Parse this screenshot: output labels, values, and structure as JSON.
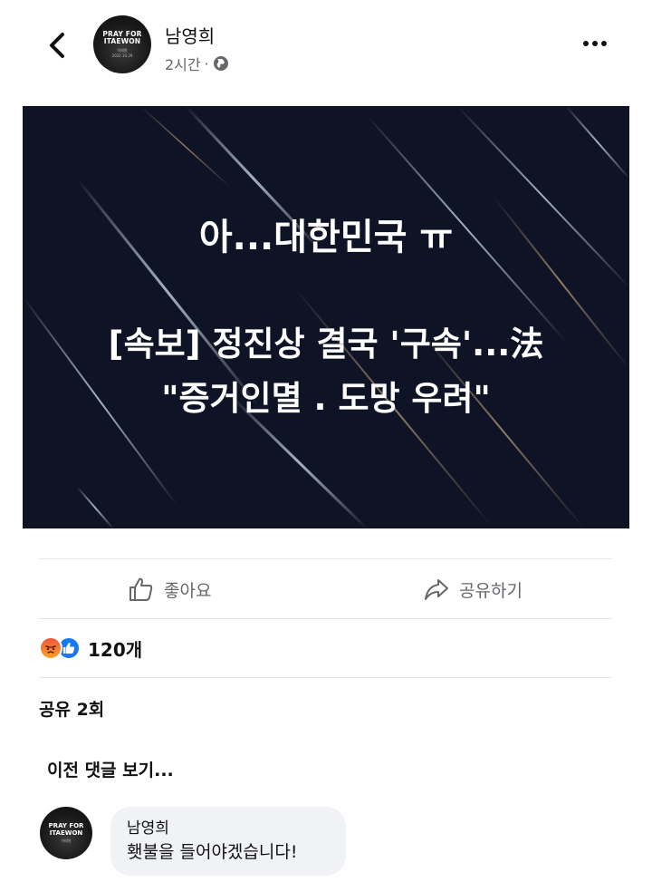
{
  "post": {
    "author": "남영희",
    "time": "2시간",
    "separator": "·",
    "avatar_text": {
      "line1": "PRAY FOR",
      "line2": "ITAEWON",
      "line3": "이태원",
      "line4": "2022.10.29"
    },
    "image_text": {
      "line1": "아...대한민국 ㅠ",
      "line2": "[속보] 정진상 결국 '구속'...法",
      "line3": "\"증거인멸 . 도망 우려\""
    }
  },
  "actions": {
    "like_label": "좋아요",
    "share_label": "공유하기"
  },
  "reactions": {
    "count": "120개"
  },
  "shares": {
    "label": "공유 2회"
  },
  "comments": {
    "view_previous": "이전 댓글 보기...",
    "items": [
      {
        "author": "남영희",
        "text": "횃불을 들어야겠습니다!"
      }
    ]
  },
  "icons": {
    "back": "back-arrow-icon",
    "more": "more-options-icon",
    "globe": "globe-icon",
    "like": "thumbs-up-icon",
    "share": "share-arrow-icon",
    "angry": "angry-reaction-icon",
    "like_reaction": "like-reaction-icon"
  },
  "colors": {
    "image_background": "#0f1326",
    "meta_gray": "#65676b",
    "like_blue": "#1877f2",
    "bubble_gray": "#f0f2f5"
  }
}
